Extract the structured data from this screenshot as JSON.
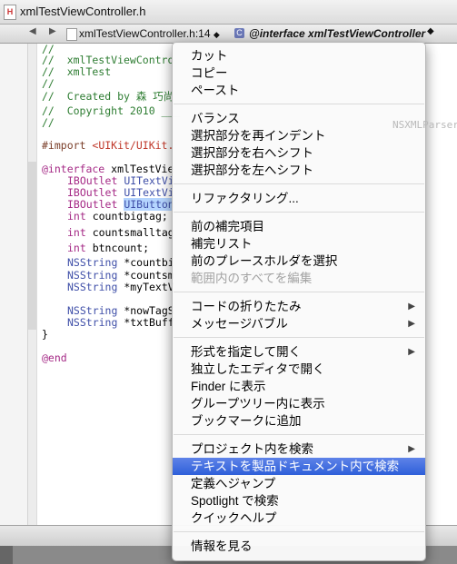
{
  "window": {
    "title": "xmlTestViewController.h",
    "file_icon": "H"
  },
  "jumpbar": {
    "back": "◀",
    "forward": "▶",
    "file": "xmlTestViewController.h:14",
    "file_arrow": "◆",
    "class_icon": "C",
    "symbol": "@interface xmlTestViewController",
    "symbol_arrow": "◆"
  },
  "code": {
    "lines": {
      "l1": "//",
      "l2": "//  xmlTestViewContro",
      "l3": "//  xmlTest",
      "l4": "//",
      "l5": "//  Created by 森 巧尚",
      "l6": "//  Copyright 2010 ___",
      "l7": "//",
      "l8_kw": "#import ",
      "l8_path": "<UIKit/UIKit.",
      "l9_kw": "@interface",
      "l9_rest": " xmlTestVie",
      "l10_kw": "IBOutlet",
      "l10_rest": " UITextVi",
      "l11_kw": "IBOutlet",
      "l11_rest": " UITextVi",
      "l12_kw": "IBOutlet",
      "l12_sel": "UIButton",
      "l13_kw": "int",
      "l13_rest": " countbigtag;",
      "l14_kw": "int",
      "l14_rest": " countsmalltag",
      "l15_kw": "int",
      "l15_rest": " btncount;",
      "l16_kw": "NSString",
      "l16_rest": " *countbi",
      "l17_kw": "NSString",
      "l17_rest": " *countsm",
      "l18_kw": "NSString",
      "l18_rest": " *myTextV",
      "l19_kw": "NSString",
      "l19_rest": " *nowTagS",
      "l20_kw": "NSString",
      "l20_rest": " *txtBuff",
      "l21": "}",
      "l22": "@end"
    },
    "ghost_delegate": "NSXMLParserDe"
  },
  "context_menu": {
    "cut": "カット",
    "copy": "コピー",
    "paste": "ペースト",
    "balance": "バランス",
    "reindent": "選択部分を再インデント",
    "shift_right": "選択部分を右へシフト",
    "shift_left": "選択部分を左へシフト",
    "refactor": "リファクタリング...",
    "prev_completion": "前の補完項目",
    "completion_list": "補完リスト",
    "select_prev_placeholder": "前のプレースホルダを選択",
    "edit_all_in_scope": "範囲内のすべてを編集",
    "code_folding": "コードの折りたたみ",
    "message_bubbles": "メッセージバブル",
    "open_as": "形式を指定して開く",
    "open_separate_editor": "独立したエディタで開く",
    "show_in_finder": "Finder に表示",
    "show_in_group_tree": "グループツリー内に表示",
    "add_bookmark": "ブックマークに追加",
    "find_in_project": "プロジェクト内を検索",
    "search_in_docs": "テキストを製品ドキュメント内で検索",
    "jump_to_definition": "定義へジャンプ",
    "spotlight_search": "Spotlight で検索",
    "quick_help": "クイックヘルプ",
    "get_info": "情報を見る",
    "submenu_arrow": "▶"
  }
}
